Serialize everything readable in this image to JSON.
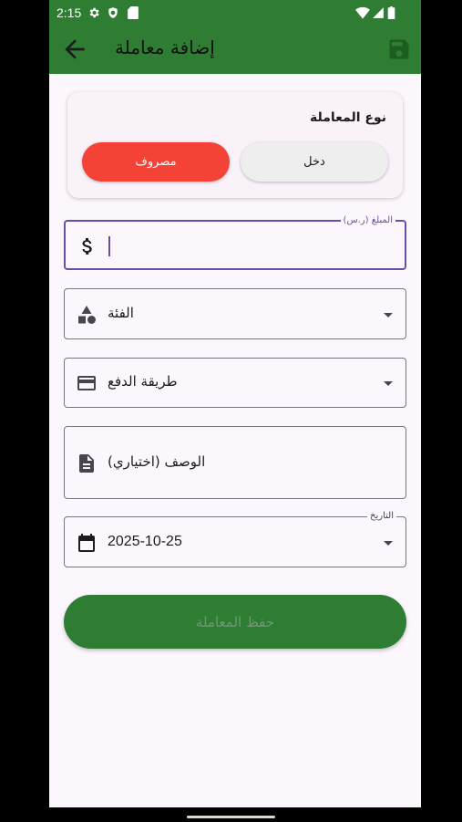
{
  "status_bar": {
    "time": "2:15"
  },
  "app_bar": {
    "title": "إضافة معاملة",
    "back_icon": "arrow-back-icon",
    "save_icon": "save-icon"
  },
  "type_card": {
    "title": "نوع المعاملة",
    "expense_label": "مصروف",
    "income_label": "دخل",
    "selected": "expense"
  },
  "amount_field": {
    "label": "المبلغ (ر.س)",
    "value": "",
    "icon": "dollar-icon"
  },
  "category_field": {
    "placeholder": "الفئة",
    "icon": "category-shapes-icon"
  },
  "payment_field": {
    "placeholder": "طريقة الدفع",
    "icon": "credit-card-icon"
  },
  "description_field": {
    "placeholder": "الوصف (اختياري)",
    "icon": "document-icon"
  },
  "date_field": {
    "label": "التاريخ",
    "value": "2025-10-25",
    "icon": "calendar-icon"
  },
  "submit": {
    "label": "حفظ المعاملة"
  },
  "colors": {
    "primary": "#2e7d32",
    "expense": "#f44336",
    "focus": "#6750a4",
    "background": "#fcf7fc"
  }
}
